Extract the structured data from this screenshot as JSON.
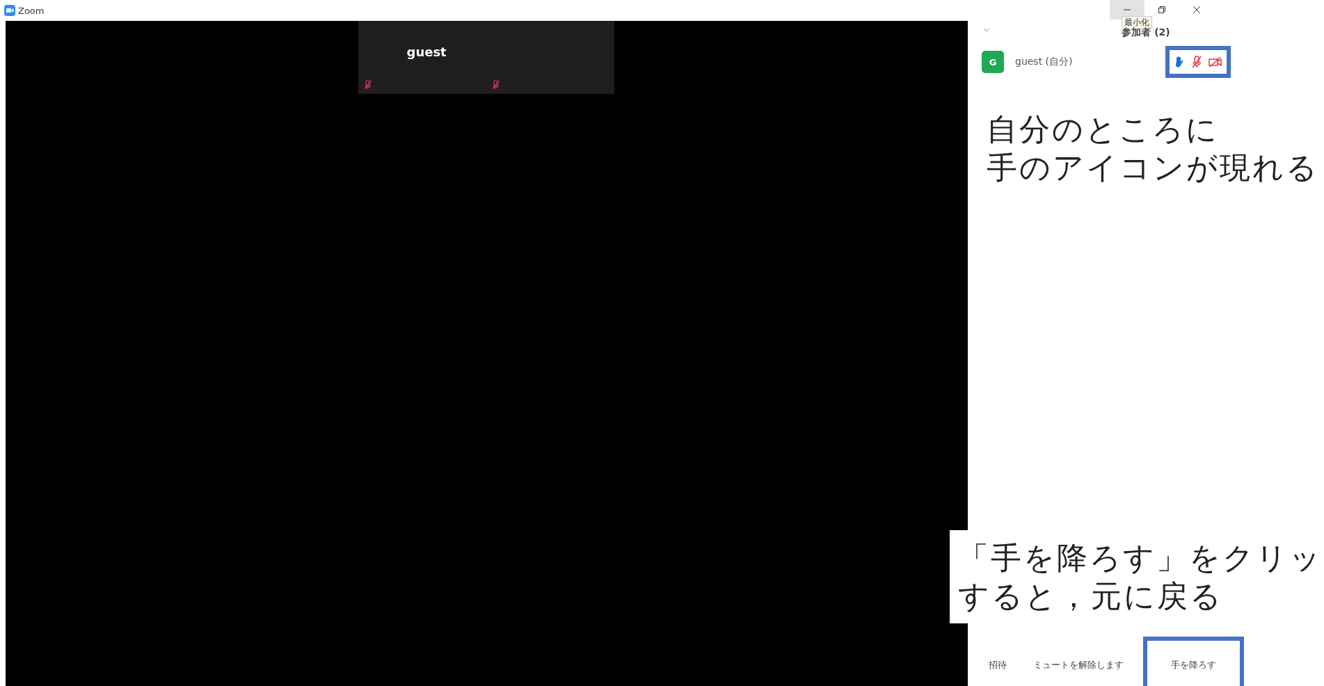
{
  "window": {
    "title": "Zoom",
    "controls": [
      {
        "kind": "minimize",
        "hovered": true
      },
      {
        "kind": "restore",
        "hovered": false
      },
      {
        "kind": "close",
        "hovered": false
      }
    ],
    "tooltip": "最小化"
  },
  "video": {
    "tiles": [
      {
        "name": "guest",
        "muted": true
      },
      {
        "muted": true
      }
    ]
  },
  "panel": {
    "title": "参加者 (2)",
    "participants": [
      {
        "initial": "G",
        "name": "guest (自分)",
        "hand_raised": true,
        "muted": true,
        "video_off": true,
        "highlighted": true
      }
    ],
    "buttons": [
      {
        "label": "招待",
        "highlighted": false
      },
      {
        "label": "ミュートを解除します",
        "highlighted": false
      },
      {
        "label": "手を降ろす",
        "highlighted": true
      }
    ]
  },
  "annotations": [
    {
      "lines": [
        "自分のところに",
        "手のアイコンが現れる"
      ]
    },
    {
      "lines": [
        "「手を降ろす」をクリッ",
        "すると，元に戻る"
      ]
    }
  ]
}
